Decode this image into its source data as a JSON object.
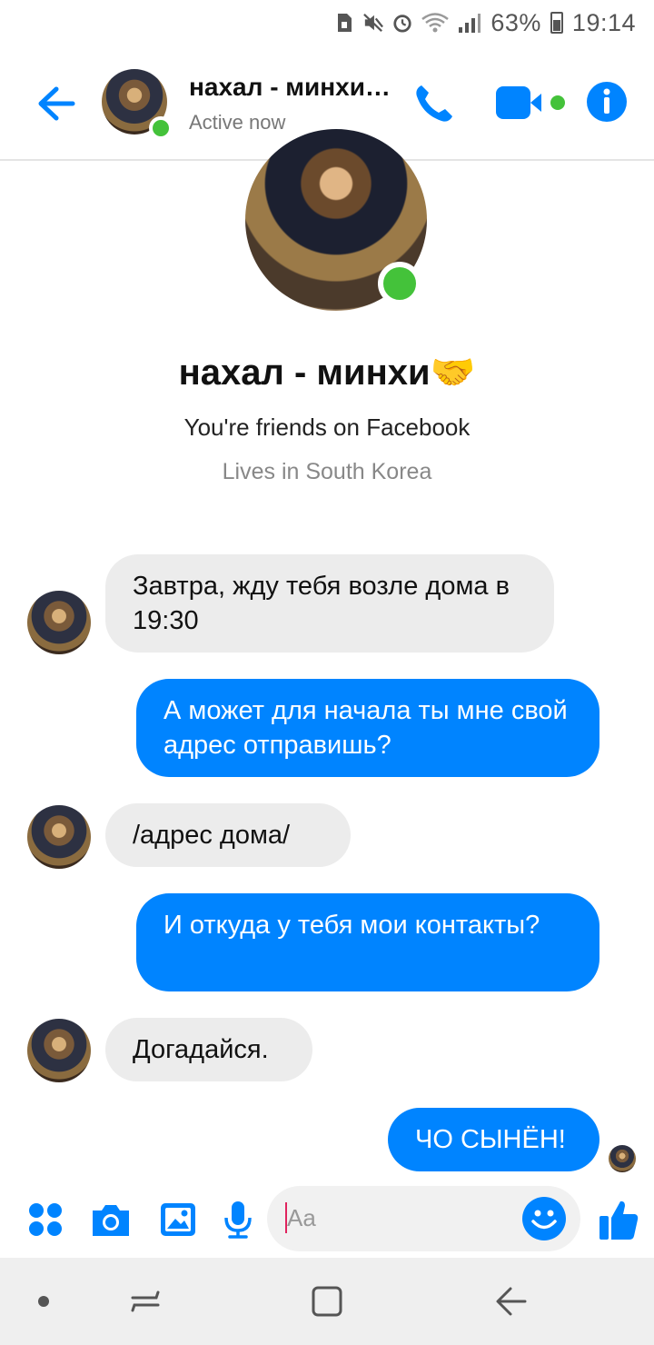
{
  "status_bar": {
    "battery_text": "63%",
    "time": "19:14",
    "icons": [
      "sim-icon",
      "mute-icon",
      "alarm-icon",
      "wifi-icon",
      "signal-icon",
      "battery-icon"
    ]
  },
  "header": {
    "name": "нахал - минхи…",
    "status": "Active now",
    "icons": [
      "back-arrow-icon",
      "phone-icon",
      "video-camera-icon",
      "info-icon"
    ],
    "accent": "#0084ff",
    "online_color": "#44c23a"
  },
  "profile": {
    "name": "нахал - минхи🤝",
    "line1": "You're friends on Facebook",
    "line2": "Lives in South Korea"
  },
  "messages": [
    {
      "direction": "in",
      "text": "Завтра, жду тебя возле дома в 19:30"
    },
    {
      "direction": "out",
      "text": "А может для начала ты мне свой адрес отправишь?"
    },
    {
      "direction": "in",
      "text": "/адрес дома/"
    },
    {
      "direction": "out",
      "text": "И откуда у тебя мои контакты?"
    },
    {
      "direction": "in",
      "text": "Догадайся."
    },
    {
      "direction": "out",
      "text": "ЧО СЫНЁН!"
    }
  ],
  "composer": {
    "placeholder": "Aa",
    "icons": [
      "apps-icon",
      "camera-icon",
      "gallery-icon",
      "microphone-icon",
      "emoji-icon",
      "thumbs-up-icon"
    ]
  },
  "navbar": {
    "icons": [
      "nav-dot-icon",
      "recents-icon",
      "home-icon",
      "back-icon"
    ]
  }
}
